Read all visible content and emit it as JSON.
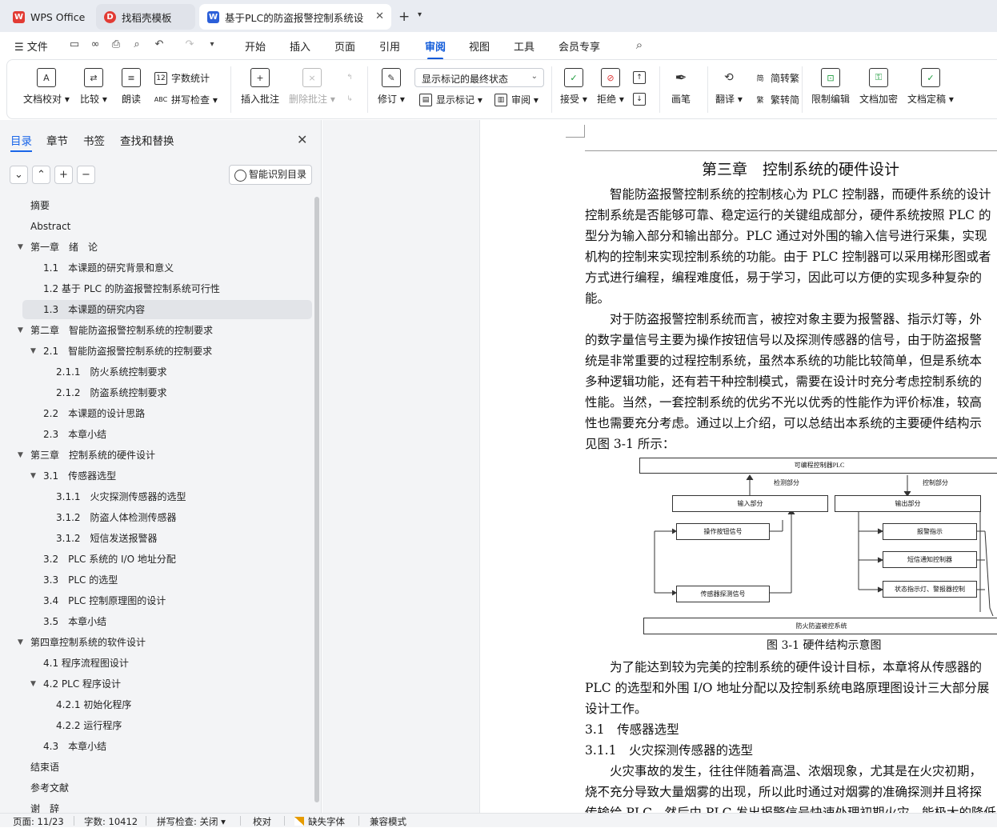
{
  "tabs": [
    {
      "label": "WPS Office"
    },
    {
      "label": "找稻壳模板"
    },
    {
      "label": "基于PLC的防盗报警控制系统设"
    }
  ],
  "colors": {
    "accent": "#0f5ad9",
    "wps_red": "#e23b34",
    "doc_blue": "#2b5fd9",
    "tab_bg": "#e9ecf2",
    "pane_bg": "#f3f4f6"
  },
  "menu": {
    "file_label": "文件",
    "items": [
      "开始",
      "插入",
      "页面",
      "引用",
      "审阅",
      "视图",
      "工具",
      "会员专享"
    ],
    "active": "审阅"
  },
  "ribbon": {
    "proofread": "文档校对",
    "compare": "比较",
    "read_aloud": "朗读",
    "word_count": "字数统计",
    "spell_check": "拼写检查",
    "insert_comment": "插入批注",
    "delete_comment": "删除批注",
    "track_changes": "修订",
    "markup_mode": "显示标记的最终状态",
    "show_markup": "显示标记",
    "review_pane": "审阅",
    "accept": "接受",
    "reject": "拒绝",
    "ink": "画笔",
    "translate": "翻译",
    "to_traditional": "简转繁",
    "to_simplified": "繁转简",
    "restrict_edit": "限制编辑",
    "encrypt": "文档加密",
    "finalize": "文档定稿"
  },
  "nav": {
    "tabs": [
      "目录",
      "章节",
      "书签",
      "查找和替换"
    ],
    "smart_toc": "智能识别目录",
    "items": [
      {
        "level": 1,
        "text": "摘要",
        "arrow": false
      },
      {
        "level": 1,
        "text": "Abstract",
        "arrow": false
      },
      {
        "level": 1,
        "text": "第一章　绪　论",
        "arrow": true
      },
      {
        "level": 2,
        "text": "1.1　本课题的研究背景和意义",
        "arrow": false
      },
      {
        "level": 2,
        "text": "1.2  基于 PLC 的防盗报警控制系统可行性",
        "arrow": false
      },
      {
        "level": 2,
        "text": "1.3　本课题的研究内容",
        "arrow": false,
        "selected": true
      },
      {
        "level": 1,
        "text": "第二章　智能防盗报警控制系统的控制要求",
        "arrow": true
      },
      {
        "level": 2,
        "text": "2.1　智能防盗报警控制系统的控制要求",
        "arrow": true
      },
      {
        "level": 3,
        "text": "2.1.1　防火系统控制要求",
        "arrow": false
      },
      {
        "level": 3,
        "text": "2.1.2　防盗系统控制要求",
        "arrow": false
      },
      {
        "level": 2,
        "text": "2.2　本课题的设计思路",
        "arrow": false
      },
      {
        "level": 2,
        "text": "2.3　本章小结",
        "arrow": false
      },
      {
        "level": 1,
        "text": "第三章　控制系统的硬件设计",
        "arrow": true
      },
      {
        "level": 2,
        "text": "3.1　传感器选型",
        "arrow": true
      },
      {
        "level": 3,
        "text": "3.1.1　火灾探测传感器的选型",
        "arrow": false
      },
      {
        "level": 3,
        "text": "3.1.2　防盗人体检测传感器",
        "arrow": false
      },
      {
        "level": 3,
        "text": "3.1.2　短信发送报警器",
        "arrow": false
      },
      {
        "level": 2,
        "text": "3.2　PLC 系统的 I/O 地址分配",
        "arrow": false
      },
      {
        "level": 2,
        "text": "3.3　PLC 的选型",
        "arrow": false
      },
      {
        "level": 2,
        "text": "3.4　PLC 控制原理图的设计",
        "arrow": false
      },
      {
        "level": 2,
        "text": "3.5　本章小结",
        "arrow": false
      },
      {
        "level": 1,
        "text": "第四章控制系统的软件设计",
        "arrow": true
      },
      {
        "level": 2,
        "text": "4.1  程序流程图设计",
        "arrow": false
      },
      {
        "level": 2,
        "text": "4.2 PLC 程序设计",
        "arrow": true
      },
      {
        "level": 3,
        "text": "4.2.1  初始化程序",
        "arrow": false
      },
      {
        "level": 3,
        "text": "4.2.2  运行程序",
        "arrow": false
      },
      {
        "level": 2,
        "text": "4.3　本章小结",
        "arrow": false
      },
      {
        "level": 1,
        "text": "结束语",
        "arrow": false
      },
      {
        "level": 1,
        "text": "参考文献",
        "arrow": false
      },
      {
        "level": 1,
        "text": "谢　辞",
        "arrow": false
      }
    ]
  },
  "doc": {
    "title": "第三章　控制系统的硬件设计",
    "lines_a": [
      {
        "text": "智能防盗报警控制系统的控制核心为 PLC 控制器，而硬件系统的设计",
        "indent": true
      },
      {
        "text": "控制系统是否能够可靠、稳定运行的关键组成部分，硬件系统按照 PLC 的",
        "indent": false
      },
      {
        "text": "型分为输入部分和输出部分。PLC 通过对外围的输入信号进行采集，实现",
        "indent": false
      },
      {
        "text": "机构的控制来实现控制系统的功能。由于 PLC 控制器可以采用梯形图或者",
        "indent": false
      },
      {
        "text": "方式进行编程，编程难度低，易于学习，因此可以方便的实现多种复杂的",
        "indent": false
      },
      {
        "text": "能。",
        "indent": false
      },
      {
        "text": "对于防盗报警控制系统而言，被控对象主要为报警器、指示灯等，外",
        "indent": true
      },
      {
        "text": "的数字量信号主要为操作按钮信号以及探测传感器的信号，由于防盗报警",
        "indent": false
      },
      {
        "text": "统是非常重要的过程控制系统，虽然本系统的功能比较简单，但是系统本",
        "indent": false
      },
      {
        "text": "多种逻辑功能，还有若干种控制模式，需要在设计时充分考虑控制系统的",
        "indent": false
      },
      {
        "text": "性能。当然，一套控制系统的优劣不光以优秀的性能作为评价标准，较高",
        "indent": false
      },
      {
        "text": "性也需要充分考虑。通过以上介绍，可以总结出本系统的主要硬件结构示",
        "indent": false
      },
      {
        "text": "见图 3-1 所示：",
        "indent": false
      }
    ],
    "figure": {
      "plc": "可编程控制器PLC",
      "detect": "检测部分",
      "control": "控制部分",
      "input": "输入部分",
      "output": "输出部分",
      "button": "操作按钮信号",
      "sensor": "传感器探测信号",
      "alarm": "报警指示",
      "sms": "短信通知控制器",
      "status": "状态指示灯、警报器控制",
      "system": "防火防盗被控系统",
      "caption": "图 3-1  硬件结构示意图"
    },
    "lines_b": [
      {
        "text": "为了能达到较为完美的控制系统的硬件设计目标，本章将从传感器的",
        "indent": true
      },
      {
        "text": "PLC 的选型和外围 I/O 地址分配以及控制系统电路原理图设计三大部分展",
        "indent": false
      },
      {
        "text": "设计工作。",
        "indent": false
      },
      {
        "text": "3.1　传感器选型",
        "indent": false
      },
      {
        "text": "3.1.1　火灾探测传感器的选型",
        "indent": false
      },
      {
        "text": "火灾事故的发生，往往伴随着高温、浓烟现象，尤其是在火灾初期，",
        "indent": true
      },
      {
        "text": "烧不充分导致大量烟雾的出现，所以此时通过对烟雾的准确探测并且将探",
        "indent": false
      },
      {
        "text": "传输给 PLC，然后由 PLC 发出报警信号快速处理初期火灾，能极大的降低",
        "indent": false
      }
    ]
  },
  "status": {
    "page": "页面: 11/23",
    "words": "字数: 10412",
    "spell": "拼写检查: 关闭",
    "proof": "校对",
    "missing_font": "缺失字体",
    "compat": "兼容模式"
  }
}
